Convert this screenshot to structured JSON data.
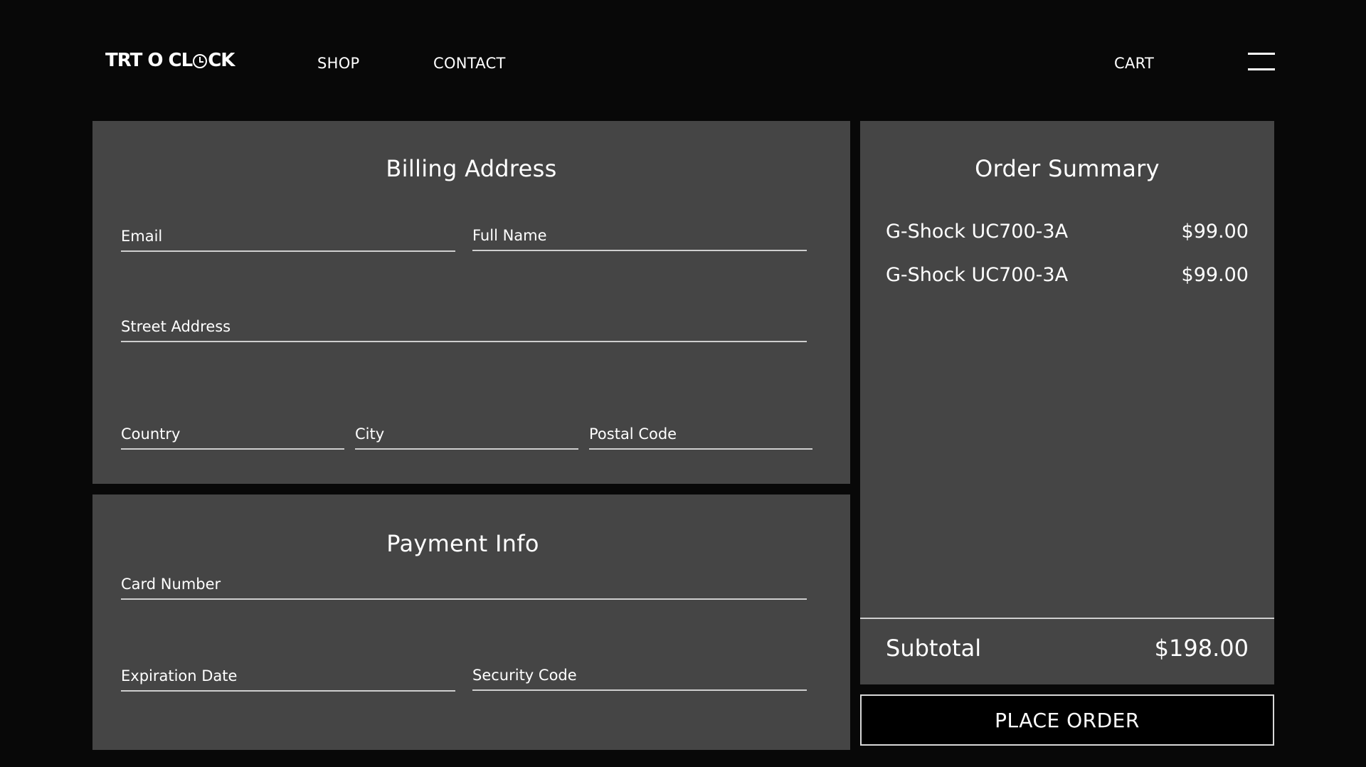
{
  "header": {
    "logo_left": "TRT O CL",
    "logo_right": "CK",
    "nav": {
      "shop": "SHOP",
      "contact": "CONTACT",
      "cart": "CART"
    },
    "menu_icon": "hamburger-menu-icon"
  },
  "billing": {
    "title": "Billing Address",
    "email": {
      "placeholder": "Email",
      "value": ""
    },
    "full_name": {
      "placeholder": "Full Name",
      "value": ""
    },
    "street": {
      "placeholder": "Street Address",
      "value": ""
    },
    "country": {
      "placeholder": "Country",
      "value": ""
    },
    "city": {
      "placeholder": "City",
      "value": ""
    },
    "postal": {
      "placeholder": "Postal Code",
      "value": ""
    }
  },
  "payment": {
    "title": "Payment Info",
    "card_number": {
      "placeholder": "Card Number",
      "value": ""
    },
    "expiration": {
      "placeholder": "Expiration Date",
      "value": ""
    },
    "security_code": {
      "placeholder": "Security Code",
      "value": ""
    }
  },
  "summary": {
    "title": "Order Summary",
    "items": [
      {
        "name": "G-Shock UC700-3A",
        "price": "$99.00"
      },
      {
        "name": "G-Shock UC700-3A",
        "price": "$99.00"
      }
    ],
    "subtotal_label": "Subtotal",
    "subtotal_value": "$198.00"
  },
  "place_order_label": "PLACE ORDER",
  "colors": {
    "background": "#080808",
    "panel": "#454545",
    "text": "#ffffff",
    "underline": "#cfcfcf"
  }
}
